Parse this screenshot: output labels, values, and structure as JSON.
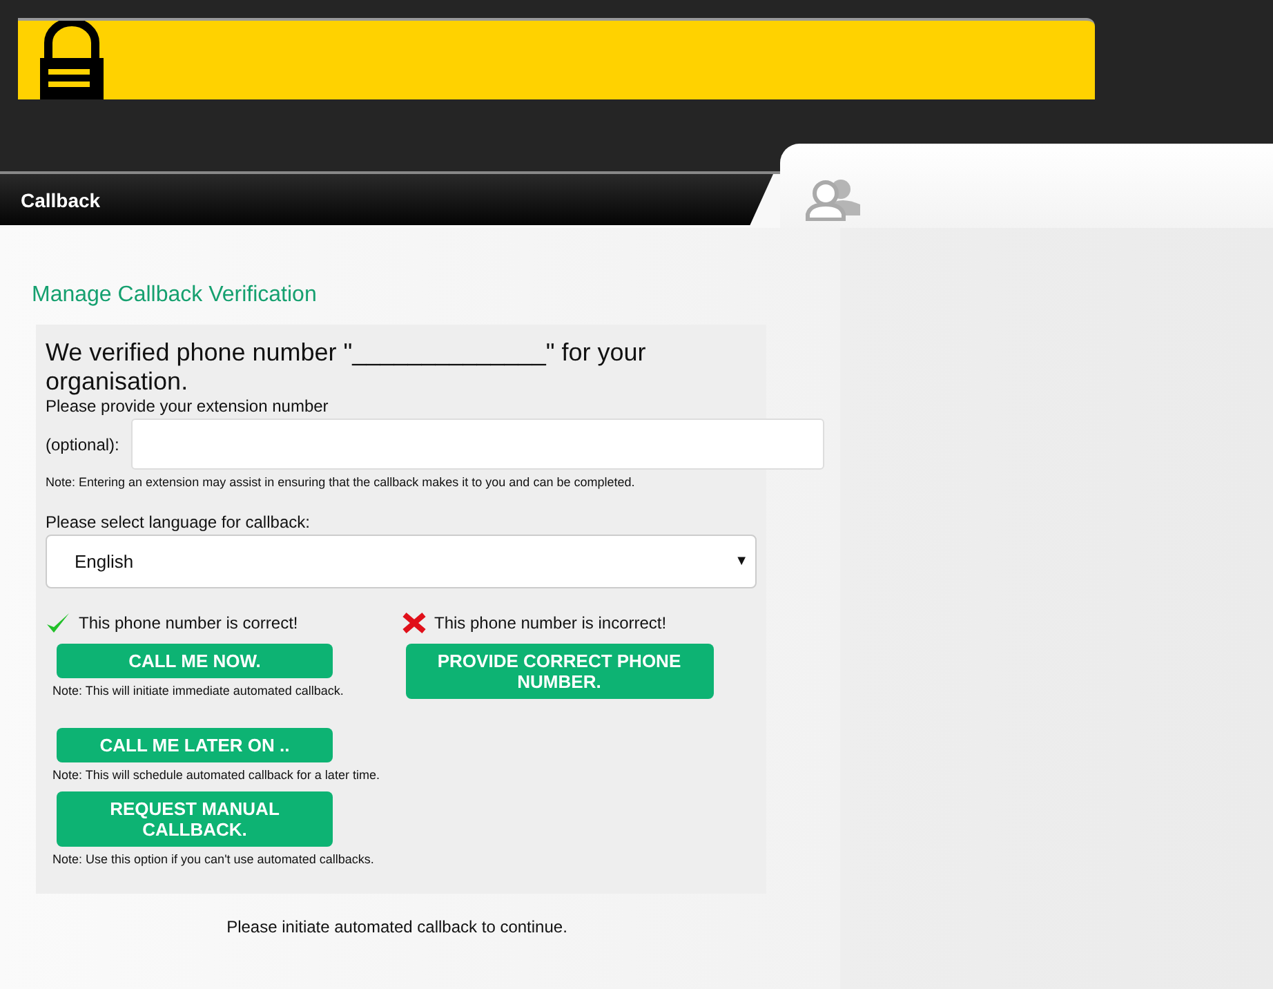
{
  "header": {
    "tab": "Callback"
  },
  "title": "Manage Callback Verification",
  "form": {
    "heading": "We verified phone number \"______________\" for your organisation.",
    "extension_label_1": "Please provide your extension number",
    "extension_label_2": "(optional):",
    "extension_note": "Note: Entering an extension may assist in ensuring that the callback makes it to you and can be completed.",
    "language_label": "Please select language for callback:",
    "language_value": "English",
    "language_caret": "▼",
    "correct": {
      "label": "This phone number is correct!",
      "actions": [
        {
          "button": "CALL ME NOW.",
          "note": "Note: This will initiate immediate automated callback."
        },
        {
          "button": "CALL ME LATER ON ..",
          "note": "Note: This will schedule automated callback for a later time."
        },
        {
          "button": "REQUEST MANUAL CALLBACK.",
          "note": "Note: Use this option if you can't use automated callbacks."
        }
      ]
    },
    "incorrect": {
      "label": "This phone number is incorrect!",
      "button": "PROVIDE CORRECT PHONE NUMBER."
    }
  },
  "footer": "Please initiate automated callback to continue."
}
